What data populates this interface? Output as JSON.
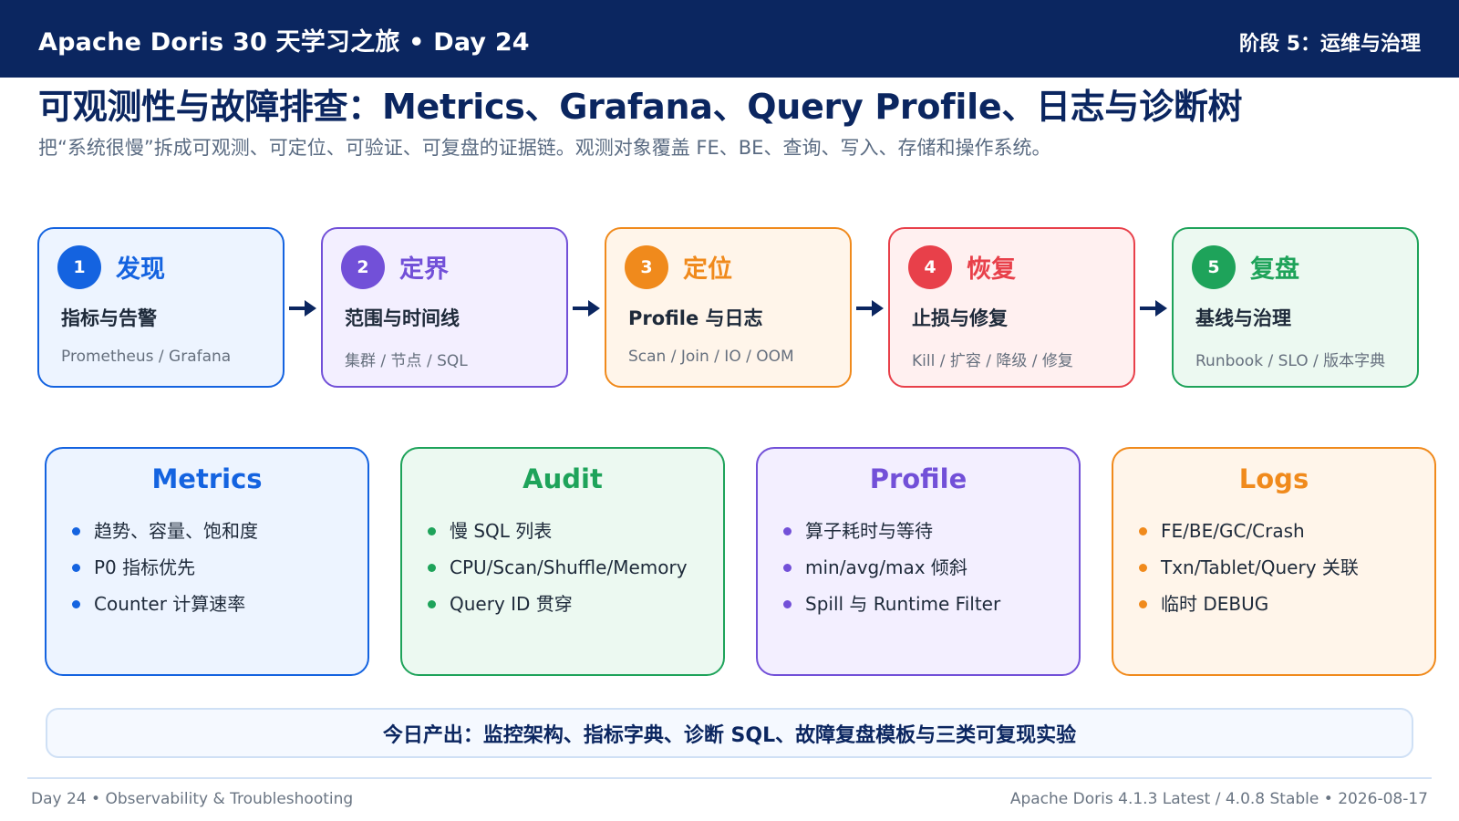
{
  "header": {
    "title": "Apache Doris 30 天学习之旅 • Day 24",
    "stage": "阶段 5：运维与治理"
  },
  "page": {
    "title": "可观测性与故障排查：Metrics、Grafana、Query Profile、日志与诊断树",
    "subtitle": "把“系统很慢”拆成可观测、可定位、可验证、可复盘的证据链。观测对象覆盖 FE、BE、查询、写入、存储和操作系统。"
  },
  "steps": [
    {
      "num": "1",
      "name": "发现",
      "title": "指标与告警",
      "detail": "Prometheus / Grafana",
      "color": "#1463e0",
      "bg": "#edf4ff"
    },
    {
      "num": "2",
      "name": "定界",
      "title": "范围与时间线",
      "detail": "集群 / 节点 / SQL",
      "color": "#7250d8",
      "bg": "#f3efff"
    },
    {
      "num": "3",
      "name": "定位",
      "title": "Profile 与日志",
      "detail": "Scan / Join / IO / OOM",
      "color": "#f08a1c",
      "bg": "#fff5ea"
    },
    {
      "num": "4",
      "name": "恢复",
      "title": "止损与修复",
      "detail": "Kill / 扩容 / 降级 / 修复",
      "color": "#e8404a",
      "bg": "#fff0f0"
    },
    {
      "num": "5",
      "name": "复盘",
      "title": "基线与治理",
      "detail": "Runbook / SLO / 版本字典",
      "color": "#1ea35a",
      "bg": "#ecf9f1"
    }
  ],
  "cards": [
    {
      "title": "Metrics",
      "color": "#1463e0",
      "bg": "#edf4ff",
      "items": [
        "趋势、容量、饱和度",
        "P0 指标优先",
        "Counter 计算速率"
      ]
    },
    {
      "title": "Audit",
      "color": "#1ea35a",
      "bg": "#ecf9f1",
      "items": [
        "慢 SQL 列表",
        "CPU/Scan/Shuffle/Memory",
        "Query ID 贯穿"
      ]
    },
    {
      "title": "Profile",
      "color": "#7250d8",
      "bg": "#f3efff",
      "items": [
        "算子耗时与等待",
        "min/avg/max 倾斜",
        "Spill 与 Runtime Filter"
      ]
    },
    {
      "title": "Logs",
      "color": "#f08a1c",
      "bg": "#fff5ea",
      "items": [
        "FE/BE/GC/Crash",
        "Txn/Tablet/Query 关联",
        "临时 DEBUG"
      ]
    }
  ],
  "output": {
    "text": "今日产出：监控架构、指标字典、诊断 SQL、故障复盘模板与三类可复现实验"
  },
  "footer": {
    "left": "Day 24 • Observability & Troubleshooting",
    "right": "Apache Doris 4.1.3 Latest / 4.0.8 Stable • 2026-08-17"
  },
  "colors": {
    "header_bg": "#0b2660",
    "arrow": "#0b2660"
  }
}
